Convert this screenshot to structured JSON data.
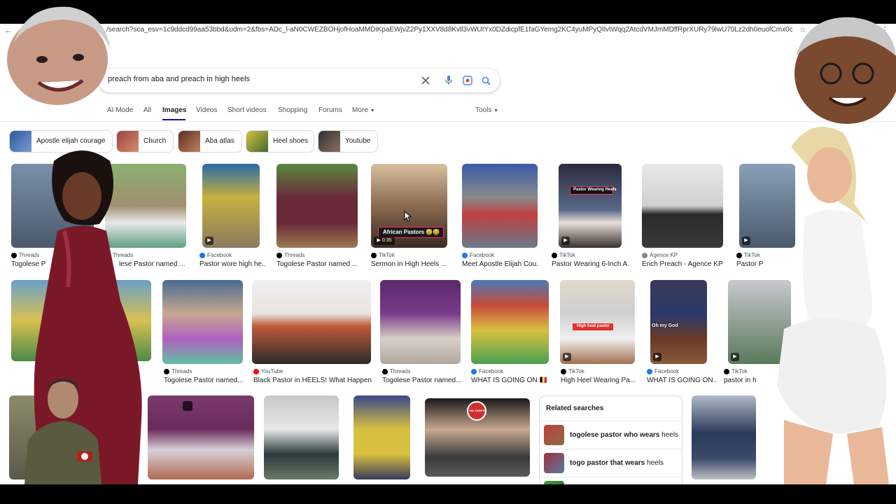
{
  "browser": {
    "url": "/search?sca_esv=1c9ddcd99aa53bbd&udm=2&fbs=ADc_l-aN0CWEZBOHjofHoaMMDiKpaEWjvZ2Py1XXV8d8Kvll3vWUtYx0DZdicpfE1faGYemg2KC4yuMPyQIlvIWqq2AtcdVMJmMDffRprXURy79lwU70Lz2dh0euofCmx0cOkSMUN_9xLa1WY..."
  },
  "search": {
    "query": "preach from aba and preach in high heels"
  },
  "tabs": [
    {
      "label": "AI Mode"
    },
    {
      "label": "All"
    },
    {
      "label": "Images"
    },
    {
      "label": "Videos"
    },
    {
      "label": "Short videos"
    },
    {
      "label": "Shopping"
    },
    {
      "label": "Forums"
    },
    {
      "label": "More"
    }
  ],
  "tools_label": "Tools",
  "chips": [
    {
      "label": "Apostle elijah courage"
    },
    {
      "label": "Church"
    },
    {
      "label": "Aba atlas"
    },
    {
      "label": "Heel shoes"
    },
    {
      "label": "Youtube"
    }
  ],
  "row1": [
    {
      "source": "Threads",
      "caption": "Togolese P"
    },
    {
      "source": "Threads",
      "caption": "lese Pastor named ..."
    },
    {
      "source": "Facebook",
      "caption": "Pastor wore high he..."
    },
    {
      "source": "Threads",
      "caption": "Togolese Pastor named ..."
    },
    {
      "source": "TikTok",
      "caption": "Sermon in High Heels ...",
      "duration": "0:35",
      "overlay": "African Pastors 😅😅"
    },
    {
      "source": "Facebook",
      "caption": "Meet Apostle Elijah Cou..."
    },
    {
      "source": "TikTok",
      "caption": "Pastor Wearing 6-Inch A...",
      "overlay": "Pastor Wearing Heels"
    },
    {
      "source": "Agence KP",
      "caption": "Erich Preach - Agence KP"
    },
    {
      "source": "TikTok",
      "caption": "Pastor P"
    }
  ],
  "row2": [
    {
      "source": "Threads",
      "caption": "Togolese Pastor named..."
    },
    {
      "source": "YouTube",
      "caption": "Black Pastor in HEELS! What Happen..."
    },
    {
      "source": "Threads",
      "caption": "Togolese Pastor named..."
    },
    {
      "source": "Facebook",
      "caption": "WHAT IS GOING ON 🇧🇪"
    },
    {
      "source": "TikTok",
      "caption": "High Heel Wearing Pa...",
      "overlay": "High heel pastor"
    },
    {
      "source": "Facebook",
      "caption": "WHAT IS GOING ON...",
      "overlay": "Oh my God"
    },
    {
      "source": "TikTok",
      "caption": "pastor in h"
    }
  ],
  "related": {
    "heading": "Related searches",
    "items": [
      {
        "bold": "togolese pastor who wears",
        "rest": "heels"
      },
      {
        "bold": "togo pastor that wears",
        "rest": "heels"
      }
    ]
  },
  "thumbnail_text": {
    "no_jumper": "NO JUMPER"
  },
  "colors": {
    "accent": "#1a0dab",
    "threads": "#000000",
    "facebook": "#1877f2",
    "tiktok": "#000000",
    "youtube": "#ff0000"
  }
}
